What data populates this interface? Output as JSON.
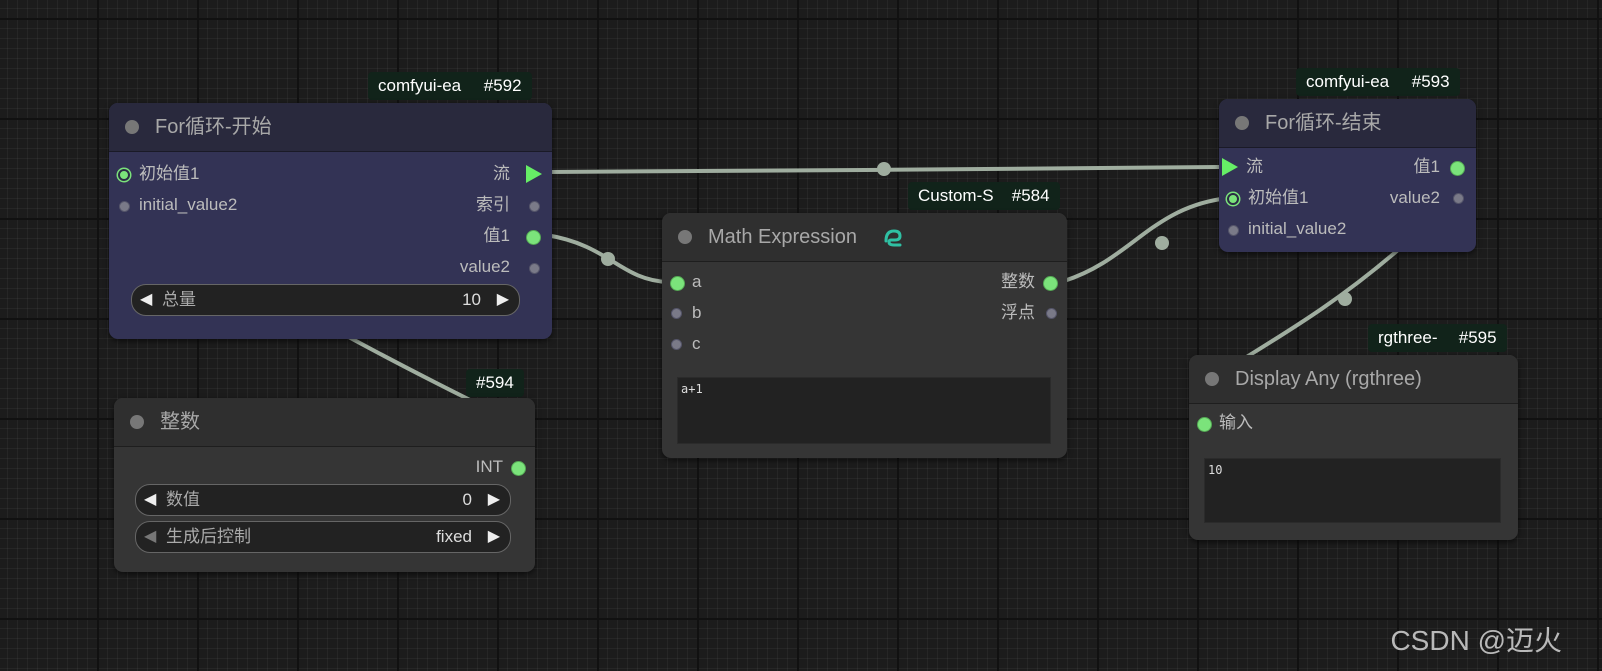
{
  "nodes": {
    "for_start": {
      "badge_name": "comfyui-ea",
      "badge_id": "#592",
      "title": "For循环-开始",
      "inputs": [
        "初始值1",
        "initial_value2"
      ],
      "outputs": [
        "流",
        "索引",
        "值1",
        "value2"
      ],
      "widget": {
        "label": "总量",
        "value": "10"
      }
    },
    "for_end": {
      "badge_name": "comfyui-ea",
      "badge_id": "#593",
      "title": "For循环-结束",
      "inputs": [
        "流",
        "初始值1",
        "initial_value2"
      ],
      "outputs": [
        "值1",
        "value2"
      ]
    },
    "math": {
      "badge_name": "Custom-S",
      "badge_id": "#584",
      "title": "Math Expression",
      "inputs": [
        "a",
        "b",
        "c"
      ],
      "outputs": [
        "整数",
        "浮点"
      ],
      "expression": "a+1"
    },
    "integer": {
      "badge_id": "#594",
      "title": "整数",
      "output": "INT",
      "widgets": [
        {
          "label": "数值",
          "value": "0"
        },
        {
          "label": "生成后控制",
          "value": "fixed"
        }
      ]
    },
    "display": {
      "badge_name": "rgthree-",
      "badge_id": "#595",
      "title": "Display Any (rgthree)",
      "input": "输入",
      "content": "10"
    }
  },
  "watermark": "CSDN @迈火",
  "colors": {
    "link": "#9fad9f",
    "pin_green": "#7be37b",
    "loop_node_bg": "#333355",
    "node_bg": "#353535",
    "badge_bg": "#11231a"
  },
  "icons": {
    "title_dot": "circle",
    "arrow_left": "◀",
    "arrow_right": "▶",
    "math_node_icon": "snake-icon"
  }
}
